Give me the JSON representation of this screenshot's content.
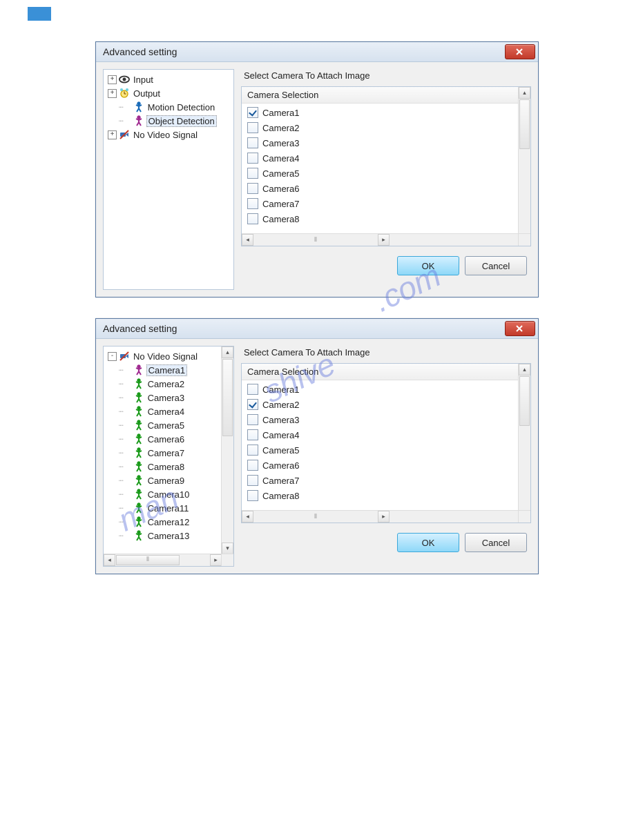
{
  "dialogs": [
    {
      "title": "Advanced setting",
      "tree": [
        {
          "label": "Input",
          "icon": "eye",
          "expander": "+",
          "indent": 0
        },
        {
          "label": "Output",
          "icon": "clock",
          "expander": "+",
          "indent": 0
        },
        {
          "label": "Motion Detection",
          "icon": "person-blue",
          "expander": "",
          "indent": 1
        },
        {
          "label": "Object Detection",
          "icon": "person-purple",
          "expander": "",
          "indent": 1,
          "selected": true
        },
        {
          "label": "No Video Signal",
          "icon": "novideo",
          "expander": "+",
          "indent": 0
        }
      ],
      "panel_label": "Select Camera To Attach Image",
      "list_header": "Camera Selection",
      "list_items": [
        {
          "label": "Camera1",
          "checked": true
        },
        {
          "label": "Camera2",
          "checked": false
        },
        {
          "label": "Camera3",
          "checked": false
        },
        {
          "label": "Camera4",
          "checked": false
        },
        {
          "label": "Camera5",
          "checked": false
        },
        {
          "label": "Camera6",
          "checked": false
        },
        {
          "label": "Camera7",
          "checked": false
        },
        {
          "label": "Camera8",
          "checked": false
        }
      ],
      "ok_label": "OK",
      "cancel_label": "Cancel",
      "tree_scroll": false
    },
    {
      "title": "Advanced setting",
      "tree": [
        {
          "label": "No Video Signal",
          "icon": "novideo",
          "expander": "-",
          "indent": 0
        },
        {
          "label": "Camera1",
          "icon": "person-purple",
          "expander": "",
          "indent": 1,
          "selected": true
        },
        {
          "label": "Camera2",
          "icon": "person-green",
          "expander": "",
          "indent": 1
        },
        {
          "label": "Camera3",
          "icon": "person-green",
          "expander": "",
          "indent": 1
        },
        {
          "label": "Camera4",
          "icon": "person-green",
          "expander": "",
          "indent": 1
        },
        {
          "label": "Camera5",
          "icon": "person-green",
          "expander": "",
          "indent": 1
        },
        {
          "label": "Camera6",
          "icon": "person-green",
          "expander": "",
          "indent": 1
        },
        {
          "label": "Camera7",
          "icon": "person-green",
          "expander": "",
          "indent": 1
        },
        {
          "label": "Camera8",
          "icon": "person-green",
          "expander": "",
          "indent": 1
        },
        {
          "label": "Camera9",
          "icon": "person-green",
          "expander": "",
          "indent": 1
        },
        {
          "label": "Camera10",
          "icon": "person-green",
          "expander": "",
          "indent": 1
        },
        {
          "label": "Camera11",
          "icon": "person-green",
          "expander": "",
          "indent": 1
        },
        {
          "label": "Camera12",
          "icon": "person-green",
          "expander": "",
          "indent": 1
        },
        {
          "label": "Camera13",
          "icon": "person-green",
          "expander": "",
          "indent": 1
        }
      ],
      "panel_label": "Select Camera To Attach Image",
      "list_header": "Camera Selection",
      "list_items": [
        {
          "label": "Camera1",
          "checked": false
        },
        {
          "label": "Camera2",
          "checked": true
        },
        {
          "label": "Camera3",
          "checked": false
        },
        {
          "label": "Camera4",
          "checked": false
        },
        {
          "label": "Camera5",
          "checked": false
        },
        {
          "label": "Camera6",
          "checked": false
        },
        {
          "label": "Camera7",
          "checked": false
        },
        {
          "label": "Camera8",
          "checked": false
        }
      ],
      "ok_label": "OK",
      "cancel_label": "Cancel",
      "tree_scroll": true
    }
  ],
  "watermark": "manualshive.com"
}
